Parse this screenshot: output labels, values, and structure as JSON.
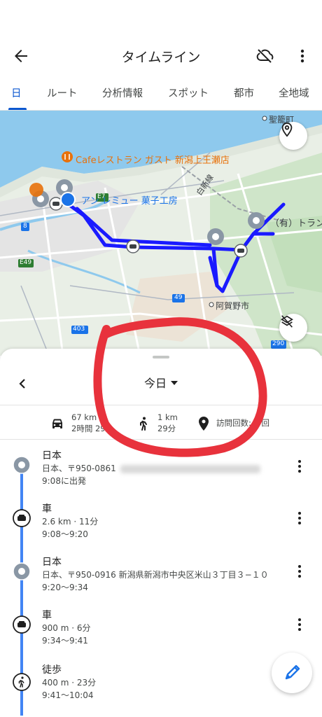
{
  "header": {
    "title": "タイムライン"
  },
  "tabs": [
    {
      "label": "日",
      "active": true
    },
    {
      "label": "ルート"
    },
    {
      "label": "分析情報"
    },
    {
      "label": "スポット"
    },
    {
      "label": "都市"
    },
    {
      "label": "全地域"
    }
  ],
  "map": {
    "labels": {
      "seiryu": "聖籠町",
      "cafe": "Cafeレストラン ガスト 新潟上王瀬店",
      "shop": "アン レミュー 菓子工房",
      "yu": "（有）トラン",
      "agano": "阿賀野市",
      "hakushin": "白新線",
      "e7": "E7",
      "e49": "E49",
      "r8": "8",
      "r403": "403",
      "r49": "49",
      "r290": "290"
    }
  },
  "date": {
    "label": "今日"
  },
  "stats": {
    "drive_distance": "67 km",
    "drive_time": "2時間 29分",
    "walk_distance": "1 km",
    "walk_time": "29分",
    "visits": "訪問回数: 3 回"
  },
  "timeline": [
    {
      "type": "place",
      "title": "日本",
      "line1": "日本、〒950-0861",
      "line2": "9:08に出発"
    },
    {
      "type": "drive",
      "title": "車",
      "line1": "2.6 km · 11分",
      "line2": "9:08〜9:20"
    },
    {
      "type": "place",
      "title": "日本",
      "line1": "日本、〒950-0916 新潟県新潟市中央区米山３丁目３−１０",
      "line2": "9:20〜9:34"
    },
    {
      "type": "drive",
      "title": "車",
      "line1": "900 m · 6分",
      "line2": "9:34〜9:41"
    },
    {
      "type": "walk",
      "title": "徒歩",
      "line1": "400 m · 23分",
      "line2": "9:41〜10:04"
    }
  ],
  "colors": {
    "accent": "#0b57d0",
    "route": "#1a1aff",
    "timeline": "#4285f4",
    "annotation": "#e8323c",
    "cafe": "#e8710a"
  },
  "icons": [
    "back-arrow-icon",
    "cloud-off-icon",
    "more-vert-icon",
    "location-pin-icon",
    "layers-off-icon",
    "chevron-left-icon",
    "car-icon",
    "walk-icon",
    "pin-icon",
    "edit-icon"
  ]
}
